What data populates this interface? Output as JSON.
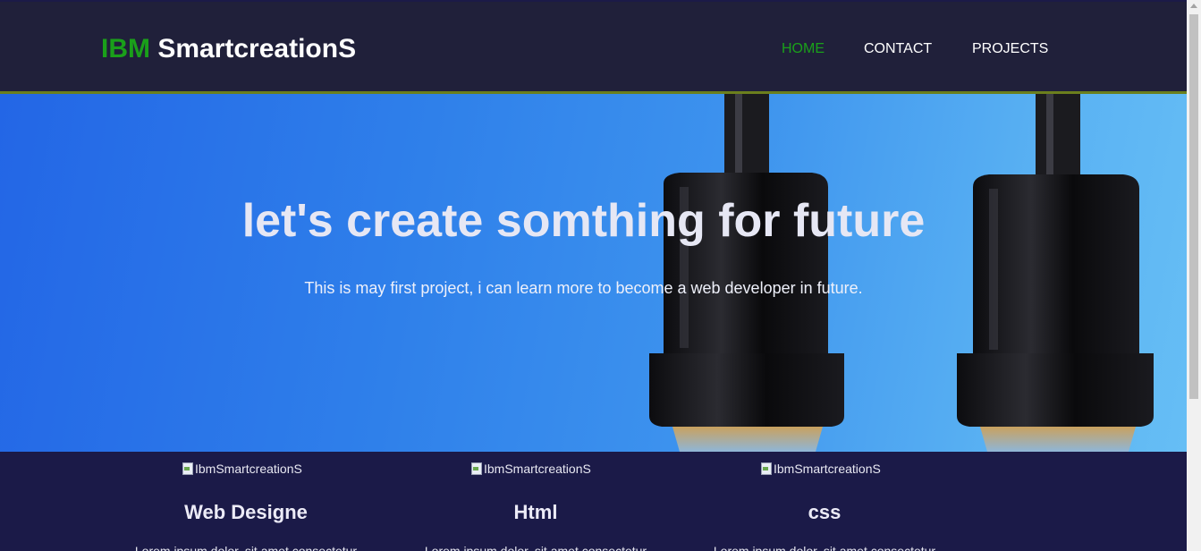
{
  "header": {
    "logo_brand": "IBM",
    "logo_rest": " SmartcreationS",
    "nav": [
      {
        "label": "HOME",
        "active": true
      },
      {
        "label": "CONTACT",
        "active": false
      },
      {
        "label": "PROJECTS",
        "active": false
      }
    ]
  },
  "hero": {
    "title": "let's create somthing for future",
    "subtitle": "This is may first project, i can learn more to become a web developer in future."
  },
  "features": [
    {
      "img_alt": "IbmSmartcreationS",
      "title": "Web Designe",
      "text": "Lorem ipsum dolor, sit amet consectetur"
    },
    {
      "img_alt": "IbmSmartcreationS",
      "title": "Html",
      "text": "Lorem ipsum dolor, sit amet consectetur"
    },
    {
      "img_alt": "IbmSmartcreationS",
      "title": "css",
      "text": "Lorem ipsum dolor, sit amet consectetur"
    }
  ],
  "colors": {
    "header_bg": "#20203a",
    "accent_green": "#1aa01a",
    "hero_blue": "#2f80ea",
    "features_bg": "#1b1a48"
  }
}
